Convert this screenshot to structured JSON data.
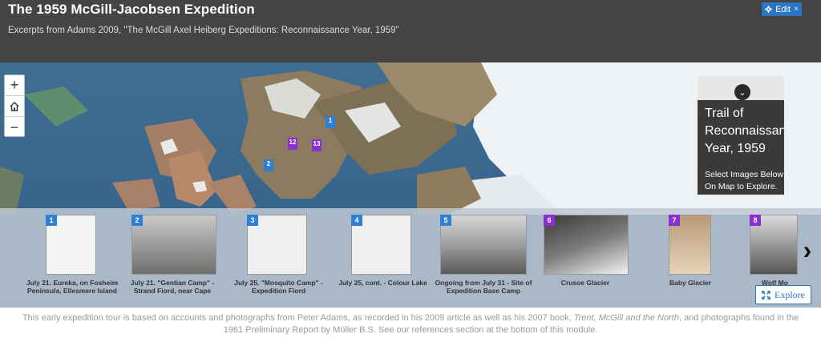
{
  "header": {
    "title": "The 1959 McGill-Jacobsen Expedition",
    "subtitle": "Excerpts from Adams 2009, \"The McGill Axel Heiberg Expeditions: Reconnaissance Year, 1959\"",
    "edit_label": "Edit",
    "edit_close": "×",
    "edit_icon": "gear-icon"
  },
  "map": {
    "zoom_in": "+",
    "home_icon": "home-icon",
    "zoom_out": "−",
    "markers": [
      {
        "label": "1",
        "color": "blue"
      },
      {
        "label": "2",
        "color": "blue"
      },
      {
        "label": "12",
        "color": "purple"
      },
      {
        "label": "13",
        "color": "purple"
      }
    ]
  },
  "panel": {
    "title_line1": "Trail of",
    "title_line2": "Reconnaissance",
    "title_line3": "Year, 1959",
    "desc_line1": "Select Images Below",
    "desc_line2": "On Map to Explore."
  },
  "carousel": {
    "items": [
      {
        "num": "1",
        "color": "blue",
        "caption_l1": "July 21. Eureka, on Fosheim",
        "caption_l2": "Peninsula, Ellesmere Island"
      },
      {
        "num": "2",
        "color": "blue",
        "caption_l1": "July 21. \"Gentian Camp\" -",
        "caption_l2": "Strand Fiord, near Cape"
      },
      {
        "num": "3",
        "color": "blue",
        "caption_l1": "July 25. \"Mosquito Camp\" -",
        "caption_l2": "Expedition Fiord"
      },
      {
        "num": "4",
        "color": "blue",
        "caption_l1": "July 25, cont. - Colour Lake",
        "caption_l2": ""
      },
      {
        "num": "5",
        "color": "blue",
        "caption_l1": "Ongoing from July 31 - Site of",
        "caption_l2": "Expedition Base Camp"
      },
      {
        "num": "6",
        "color": "purple",
        "caption_l1": "Crusoe Glacier",
        "caption_l2": ""
      },
      {
        "num": "7",
        "color": "purple",
        "caption_l1": "Baby Glacier",
        "caption_l2": ""
      },
      {
        "num": "8",
        "color": "purple",
        "caption_l1": "Wolf Mo",
        "caption_l2": ""
      }
    ],
    "next_arrow": "›",
    "explore_label": "Explore",
    "explore_icon": "expand-icon"
  },
  "footer": {
    "line1_a": "This early expedition tour is based on accounts and photographs from Peter Adams, as recorded in his 2009 article as well as his 2007 book, ",
    "line1_italic": "Trent, McGill and the North",
    "line1_b": ", and photographs found in the",
    "line2": "1961 Preliminary Report by Müller B.S. See our references section at the bottom of this module."
  }
}
